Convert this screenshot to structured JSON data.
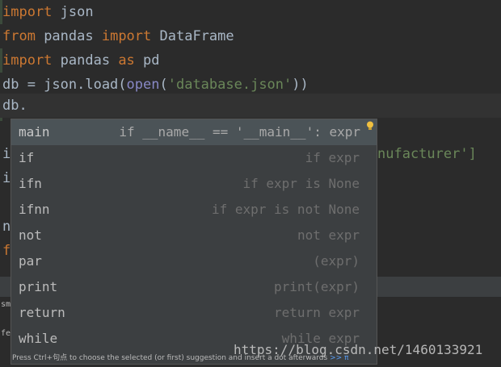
{
  "editor": {
    "line1": {
      "kw": "import",
      "rest": " json"
    },
    "line2": {
      "kw1": "from",
      "mod": " pandas ",
      "kw2": "import",
      "rest": " DataFrame"
    },
    "line3": {
      "kw1": "import",
      "mod": " pandas ",
      "kw2": "as",
      "rest": " pd"
    },
    "line4": {
      "lhs": "db = json.load(",
      "fn": "open",
      "open_paren": "(",
      "str": "'database.json'",
      "close": "))"
    },
    "line5": {
      "text": "db."
    },
    "hidden_fragments": {
      "line6_left": "i",
      "line6_right": "nufacturer']",
      "line7_left": "i",
      "line9_left": "n",
      "line10_left": "f",
      "lower1": "sm",
      "lower2": "fe"
    }
  },
  "completion": {
    "items": [
      {
        "name": "main",
        "desc": "if __name__ == '__main__': expr"
      },
      {
        "name": "if",
        "desc": "if expr"
      },
      {
        "name": "ifn",
        "desc": "if expr is None"
      },
      {
        "name": "ifnn",
        "desc": "if expr is not None"
      },
      {
        "name": "not",
        "desc": "not expr"
      },
      {
        "name": "par",
        "desc": "(expr)"
      },
      {
        "name": "print",
        "desc": "print(expr)"
      },
      {
        "name": "return",
        "desc": "return expr"
      },
      {
        "name": "while",
        "desc": "while expr"
      }
    ],
    "selected_index": 0,
    "footer_text": "Press Ctrl+句点 to choose the selected (or first) suggestion and insert a dot afterwards",
    "footer_link": ">> π"
  },
  "watermark": "https://blog.csdn.net/1460133921",
  "colors": {
    "background": "#2b2b2b",
    "keyword": "#cc7832",
    "builtin": "#8888c6",
    "string": "#6a8759",
    "popup_bg": "#3c3f41",
    "popup_selected": "#4b5357",
    "link": "#589df6"
  }
}
